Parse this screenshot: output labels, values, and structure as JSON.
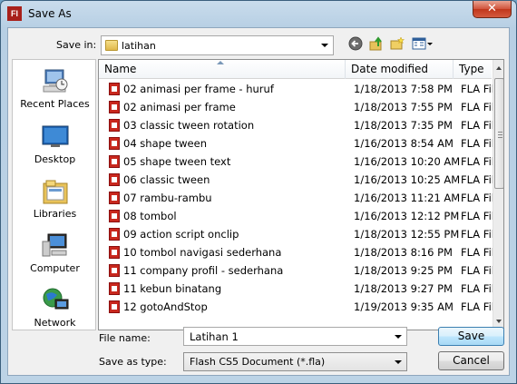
{
  "window": {
    "title": "Save As",
    "app_icon_text": "Fl",
    "close_glyph": "✕"
  },
  "save_in": {
    "label": "Save in:",
    "value": "latihan"
  },
  "toolbar": {
    "back_icon": "back-arrow-icon",
    "up_icon": "up-folder-icon",
    "new_folder_icon": "new-folder-icon",
    "views_icon": "views-menu-icon"
  },
  "places": [
    {
      "label": "Recent Places",
      "icon": "recent-places-icon"
    },
    {
      "label": "Desktop",
      "icon": "desktop-icon"
    },
    {
      "label": "Libraries",
      "icon": "libraries-icon"
    },
    {
      "label": "Computer",
      "icon": "computer-icon"
    },
    {
      "label": "Network",
      "icon": "network-icon"
    }
  ],
  "columns": {
    "name": "Name",
    "date_modified": "Date modified",
    "type": "Type"
  },
  "files": [
    {
      "name": "02 animasi per frame - huruf",
      "date": "1/18/2013 7:58 PM",
      "type": "FLA Fil"
    },
    {
      "name": "02 animasi per frame",
      "date": "1/18/2013 7:55 PM",
      "type": "FLA Fil"
    },
    {
      "name": "03 classic tween rotation",
      "date": "1/18/2013 7:35 PM",
      "type": "FLA Fil"
    },
    {
      "name": "04 shape tween",
      "date": "1/16/2013 8:54 AM",
      "type": "FLA Fil"
    },
    {
      "name": "05 shape tween text",
      "date": "1/16/2013 10:20 AM",
      "type": "FLA Fil"
    },
    {
      "name": "06 classic tween",
      "date": "1/16/2013 10:25 AM",
      "type": "FLA Fil"
    },
    {
      "name": "07 rambu-rambu",
      "date": "1/16/2013 11:21 AM",
      "type": "FLA Fil"
    },
    {
      "name": "08 tombol",
      "date": "1/16/2013 12:12 PM",
      "type": "FLA Fil"
    },
    {
      "name": "09 action script onclip",
      "date": "1/18/2013 12:55 PM",
      "type": "FLA Fil"
    },
    {
      "name": "10 tombol navigasi sederhana",
      "date": "1/18/2013 8:16 PM",
      "type": "FLA Fil"
    },
    {
      "name": "11 company profil - sederhana",
      "date": "1/18/2013 9:25 PM",
      "type": "FLA Fil"
    },
    {
      "name": "11 kebun binatang",
      "date": "1/18/2013 9:27 PM",
      "type": "FLA Fil"
    },
    {
      "name": "12 gotoAndStop",
      "date": "1/19/2013 9:35 AM",
      "type": "FLA Fil"
    }
  ],
  "file_name": {
    "label": "File name:",
    "value": "Latihan 1"
  },
  "save_as_type": {
    "label": "Save as type:",
    "value": "Flash CS5 Document (*.fla)"
  },
  "buttons": {
    "save": "Save",
    "cancel": "Cancel"
  }
}
